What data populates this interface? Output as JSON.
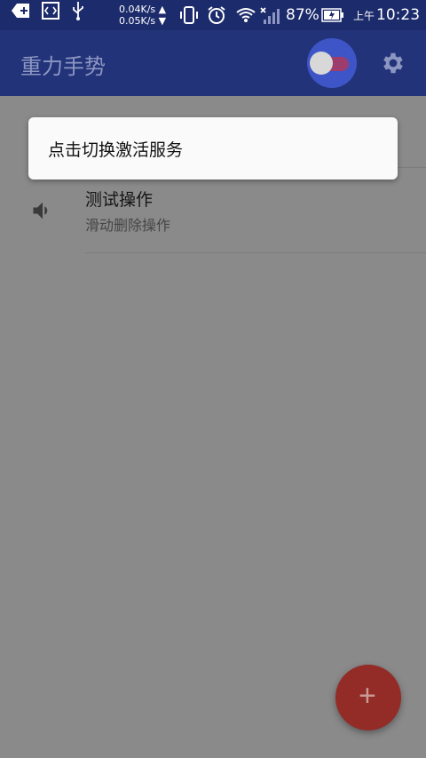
{
  "status_bar": {
    "net_up": "0.04K/s ▲",
    "net_down": "0.05K/s ▼",
    "battery_pct": "87%",
    "time_am": "上午",
    "time": "10:23"
  },
  "appbar": {
    "title": "重力手势",
    "toggle_on": false
  },
  "toast": {
    "text": "点击切换激活服务"
  },
  "list": {
    "items": [
      {
        "title": "测试操作",
        "subtitle": "滑动删除操作",
        "icon": "speaker-icon"
      }
    ]
  },
  "fab": {
    "label": "+"
  },
  "colors": {
    "status_bar": "#1c2b6b",
    "appbar": "#22337a",
    "overlay": "#8a8a8a",
    "fab": "#932b26",
    "toggle_bg": "#3e55c7",
    "toggle_track": "#9c3d6d"
  }
}
